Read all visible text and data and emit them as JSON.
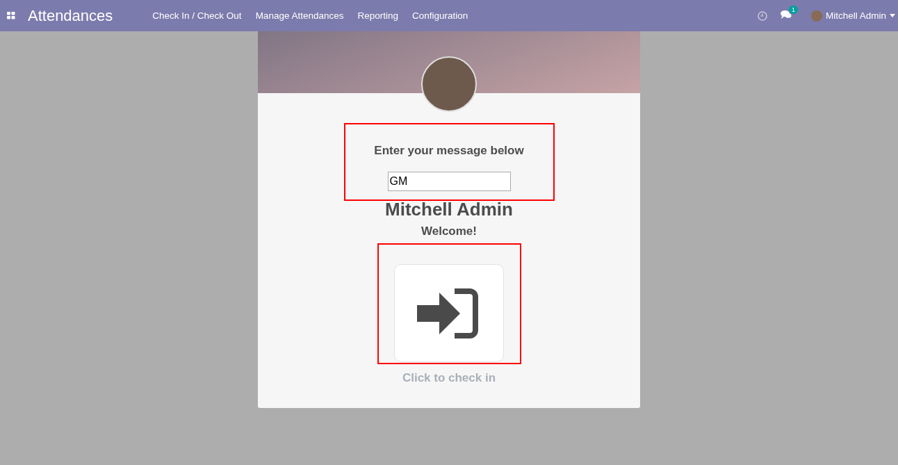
{
  "navbar": {
    "app_title": "Attendances",
    "menu": [
      {
        "label": "Check In / Check Out"
      },
      {
        "label": "Manage Attendances"
      },
      {
        "label": "Reporting"
      },
      {
        "label": "Configuration"
      }
    ],
    "messages_badge": "1",
    "user_name": "Mitchell Admin"
  },
  "kiosk": {
    "prompt": "Enter your message below",
    "message_value": "GM",
    "employee_name": "Mitchell Admin",
    "greeting": "Welcome!",
    "action_caption": "Click to check in"
  }
}
